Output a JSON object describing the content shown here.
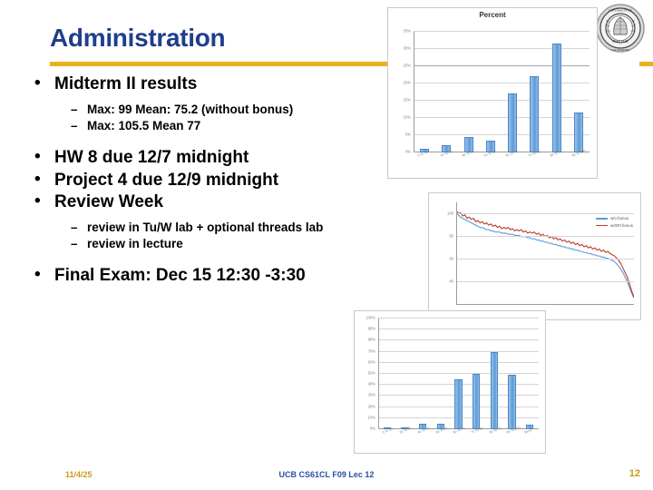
{
  "slide": {
    "title": "Administration",
    "accent_color": "#E8B11C",
    "title_color": "#1F3E8C"
  },
  "bullets": [
    {
      "level": 1,
      "text": "Midterm II results"
    },
    {
      "level": 2,
      "text": "Max: 99 Mean: 75.2 (without bonus)"
    },
    {
      "level": 2,
      "text": "Max: 105.5 Mean 77"
    },
    {
      "level": 1,
      "text": "HW 8 due 12/7 midnight"
    },
    {
      "level": 1,
      "text": "Project 4 due 12/9 midnight"
    },
    {
      "level": 1,
      "text": "Review Week"
    },
    {
      "level": 2,
      "text": "review in Tu/W lab + optional threads lab"
    },
    {
      "level": 2,
      "text": "review in lecture"
    },
    {
      "level": 1,
      "text": "Final Exam: Dec 15 12:30 -3:30"
    }
  ],
  "logo": {
    "name": "uc-berkeley-seal"
  },
  "footer": {
    "date": "11/4/25",
    "center": "UCB CS61CL F09 Lec 12",
    "page": "12"
  },
  "chart_data": [
    {
      "type": "bar",
      "title": "Percent",
      "categories": [
        "0 To 30",
        "30 To 40",
        "40 To 50",
        "50 To 60",
        "60 To 70",
        "70 To 80",
        "80 To 90",
        "90 To 100"
      ],
      "values": [
        1,
        2,
        4.5,
        3.5,
        17,
        22,
        31.5,
        11.5
      ],
      "ytick_labels": [
        "0%",
        "5%",
        "10%",
        "15%",
        "20%",
        "25%",
        "30%",
        "35%"
      ],
      "ytick_values": [
        0,
        5,
        10,
        15,
        20,
        25,
        30,
        35
      ],
      "ylim": [
        0,
        35
      ],
      "xlabel": "",
      "ylabel": "",
      "grid": true,
      "legend": "none",
      "bar_color": "#5B9BD9"
    },
    {
      "type": "line",
      "title": "",
      "ytick_labels": [
        "40",
        "60",
        "80",
        "100"
      ],
      "ytick_values": [
        40,
        60,
        80,
        100
      ],
      "ylim": [
        20,
        110
      ],
      "xlabel": "",
      "ylabel": "",
      "grid": true,
      "legend": "inside-right",
      "series": [
        {
          "name": "w/o bonus",
          "color": "#5B9BD9",
          "values": [
            100,
            99,
            97,
            96,
            95,
            94,
            93,
            92,
            91,
            90,
            89,
            88,
            88,
            87,
            86,
            86,
            85,
            85,
            84,
            84,
            84,
            83,
            83,
            83,
            82,
            82,
            82,
            81,
            81,
            81,
            80,
            80,
            80,
            79,
            79,
            78,
            78,
            77,
            77,
            76,
            76,
            75,
            75,
            74,
            74,
            73,
            73,
            72,
            72,
            71,
            71,
            70,
            70,
            69,
            69,
            68,
            68,
            67,
            67,
            66,
            66,
            65,
            65,
            64,
            64,
            63,
            63,
            62,
            62,
            61,
            61,
            60,
            59,
            58,
            56,
            54,
            51,
            48,
            44,
            40,
            35,
            30,
            26
          ]
        },
        {
          "name": "w/SRI bonus",
          "color": "#C0392B",
          "values": [
            103,
            100,
            101,
            98,
            99,
            96,
            97,
            95,
            96,
            93,
            94,
            92,
            93,
            91,
            92,
            90,
            91,
            89,
            90,
            88,
            89,
            87,
            88,
            87,
            88,
            86,
            87,
            85,
            86,
            85,
            86,
            84,
            85,
            83,
            84,
            83,
            84,
            82,
            83,
            81,
            82,
            80,
            81,
            79,
            80,
            78,
            79,
            77,
            78,
            76,
            77,
            75,
            76,
            74,
            75,
            73,
            74,
            72,
            73,
            71,
            72,
            70,
            71,
            69,
            70,
            68,
            69,
            67,
            68,
            66,
            67,
            65,
            64,
            63,
            61,
            59,
            56,
            52,
            48,
            44,
            38,
            32,
            27
          ]
        }
      ]
    },
    {
      "type": "bar",
      "title": "",
      "categories": [
        "0 To 30",
        "30 To 40",
        "40 To 50",
        "50 To 60",
        "60 To 70",
        "70 To 80",
        "80 To 90",
        "90 To 100",
        "More"
      ],
      "values": [
        1,
        2,
        5,
        5,
        45,
        50,
        70,
        49,
        4
      ],
      "ytick_labels": [
        "0%",
        "10%",
        "20%",
        "30%",
        "40%",
        "50%",
        "60%",
        "70%",
        "80%",
        "90%",
        "100%"
      ],
      "ytick_values": [
        0,
        10,
        20,
        30,
        40,
        50,
        60,
        70,
        80,
        90,
        100
      ],
      "ylim": [
        0,
        100
      ],
      "xlabel": "",
      "ylabel": "",
      "grid": true,
      "legend": "none",
      "bar_color": "#5B9BD9"
    }
  ]
}
